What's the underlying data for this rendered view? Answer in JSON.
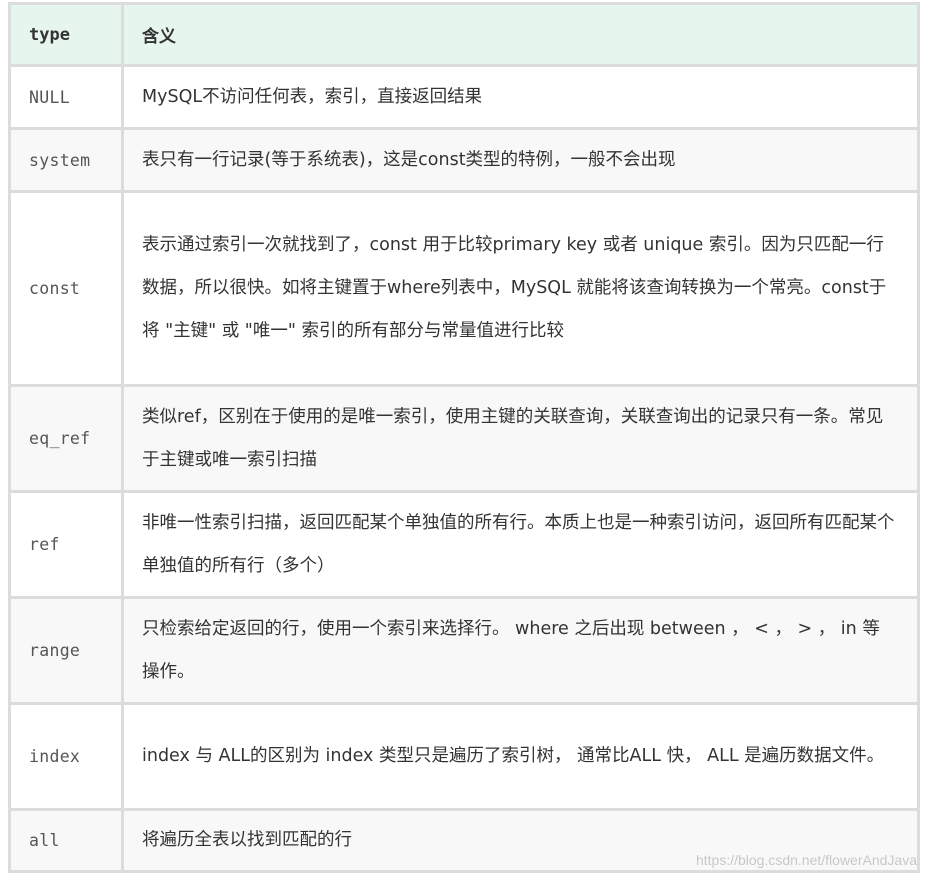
{
  "table": {
    "headers": {
      "type": "type",
      "meaning": "含义"
    },
    "rows": [
      {
        "type": "NULL",
        "meaning": "MySQL不访问任何表，索引，直接返回结果"
      },
      {
        "type": "system",
        "meaning": "表只有一行记录(等于系统表)，这是const类型的特例，一般不会出现"
      },
      {
        "type": "const",
        "meaning": "表示通过索引一次就找到了，const 用于比较primary key 或者 unique 索引。因为只匹配一行数据，所以很快。如将主键置于where列表中，MySQL 就能将该查询转换为一个常亮。const于将 \"主键\" 或 \"唯一\" 索引的所有部分与常量值进行比较"
      },
      {
        "type": "eq_ref",
        "meaning": "类似ref，区别在于使用的是唯一索引，使用主键的关联查询，关联查询出的记录只有一条。常见于主键或唯一索引扫描"
      },
      {
        "type": "ref",
        "meaning": "非唯一性索引扫描，返回匹配某个单独值的所有行。本质上也是一种索引访问，返回所有匹配某个单独值的所有行（多个）"
      },
      {
        "type": "range",
        "meaning": "只检索给定返回的行，使用一个索引来选择行。 where 之后出现 between ， < ， > ， in 等操作。"
      },
      {
        "type": "index",
        "meaning": "index 与 ALL的区别为 index 类型只是遍历了索引树， 通常比ALL 快， ALL 是遍历数据文件。"
      },
      {
        "type": "all",
        "meaning": "将遍历全表以找到匹配的行"
      }
    ]
  },
  "watermark": "https://blog.csdn.net/flowerAndJava"
}
